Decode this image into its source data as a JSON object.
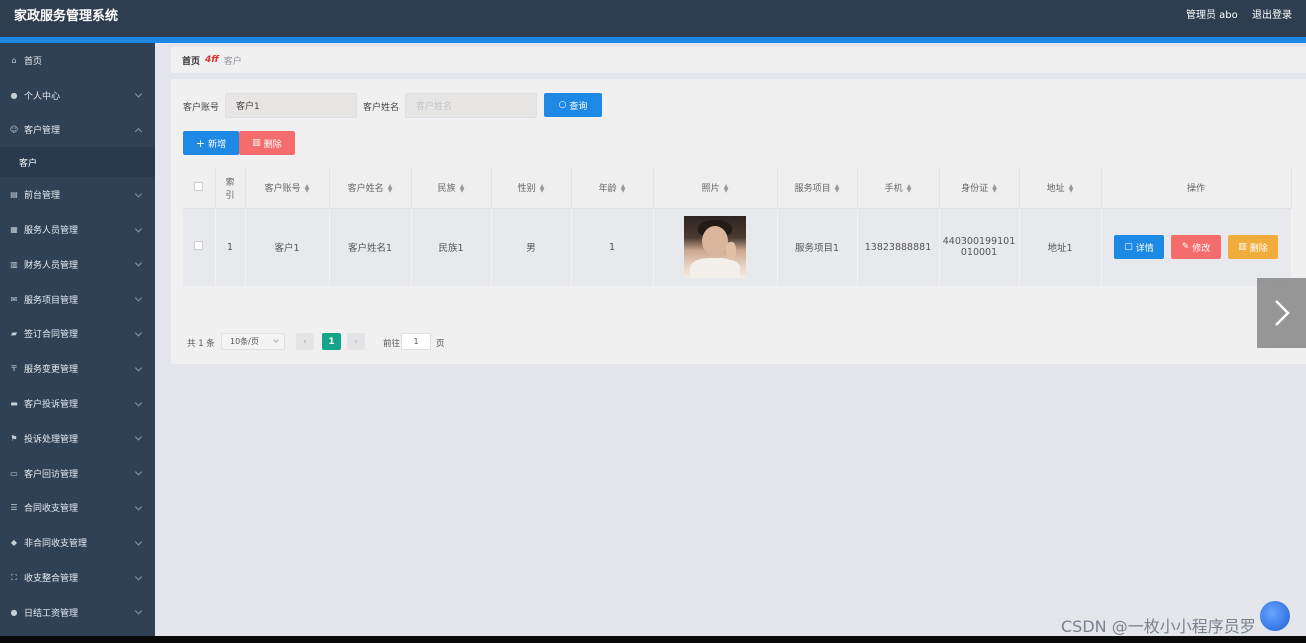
{
  "header": {
    "title": "家政服务管理系统",
    "user": "管理员 abo",
    "logout": "退出登录"
  },
  "sidebar": {
    "items": [
      {
        "label": "首页",
        "icon": "home-icon"
      },
      {
        "label": "个人中心",
        "icon": "user-icon"
      },
      {
        "label": "客户管理",
        "icon": "smile-icon",
        "expanded": true
      },
      {
        "label": "前台管理",
        "icon": "building-icon"
      },
      {
        "label": "服务人员管理",
        "icon": "team-icon"
      },
      {
        "label": "财务人员管理",
        "icon": "wallet-icon"
      },
      {
        "label": "服务项目管理",
        "icon": "mail-icon"
      },
      {
        "label": "签订合同管理",
        "icon": "handshake-icon"
      },
      {
        "label": "服务变更管理",
        "icon": "signpost-icon"
      },
      {
        "label": "客户投诉管理",
        "icon": "ticket-icon"
      },
      {
        "label": "投诉处理管理",
        "icon": "flag-icon"
      },
      {
        "label": "客户回访管理",
        "icon": "chat-icon"
      },
      {
        "label": "合同收支管理",
        "icon": "sliders-icon"
      },
      {
        "label": "非合同收支管理",
        "icon": "shield-icon"
      },
      {
        "label": "收支整合管理",
        "icon": "scan-icon"
      },
      {
        "label": "日结工资管理",
        "icon": "person-icon"
      }
    ],
    "sub_item": "客户"
  },
  "breadcrumb": {
    "home": "首页",
    "separator": "4ff",
    "current": "客户"
  },
  "search": {
    "account_label": "客户账号",
    "account_value": "客户1",
    "name_label": "客户姓名",
    "name_placeholder": "客户姓名",
    "query_button": "查询"
  },
  "actions": {
    "add": "新增",
    "delete": "删除"
  },
  "table": {
    "headers": [
      "索引",
      "客户账号",
      "客户姓名",
      "民族",
      "性别",
      "年龄",
      "照片",
      "服务项目",
      "手机",
      "身份证",
      "地址",
      "操作"
    ],
    "index_header_lines": [
      "索",
      "引"
    ],
    "row": {
      "index": "1",
      "account": "客户1",
      "name": "客户姓名1",
      "ethnicity": "民族1",
      "gender": "男",
      "age": "1",
      "service": "服务项目1",
      "phone": "13823888881",
      "id_line1": "440300199101",
      "id_line2": "010001",
      "address": "地址1"
    },
    "row_buttons": {
      "detail": "详情",
      "edit": "修改",
      "delete": "删除"
    }
  },
  "pagination": {
    "total": "共 1 条",
    "page_size": "10条/页",
    "current_page": "1",
    "goto_label": "前往",
    "goto_value": "1",
    "page_unit": "页"
  },
  "watermark": "CSDN @一枚小小程序员罗",
  "colors": {
    "header_bg": "#2e3e50",
    "sidebar_bg": "#304156",
    "accent_blue": "#1e88e5",
    "danger_red": "#f56c6c",
    "warning_orange": "#f0ad3c",
    "page_active": "#17a589"
  }
}
